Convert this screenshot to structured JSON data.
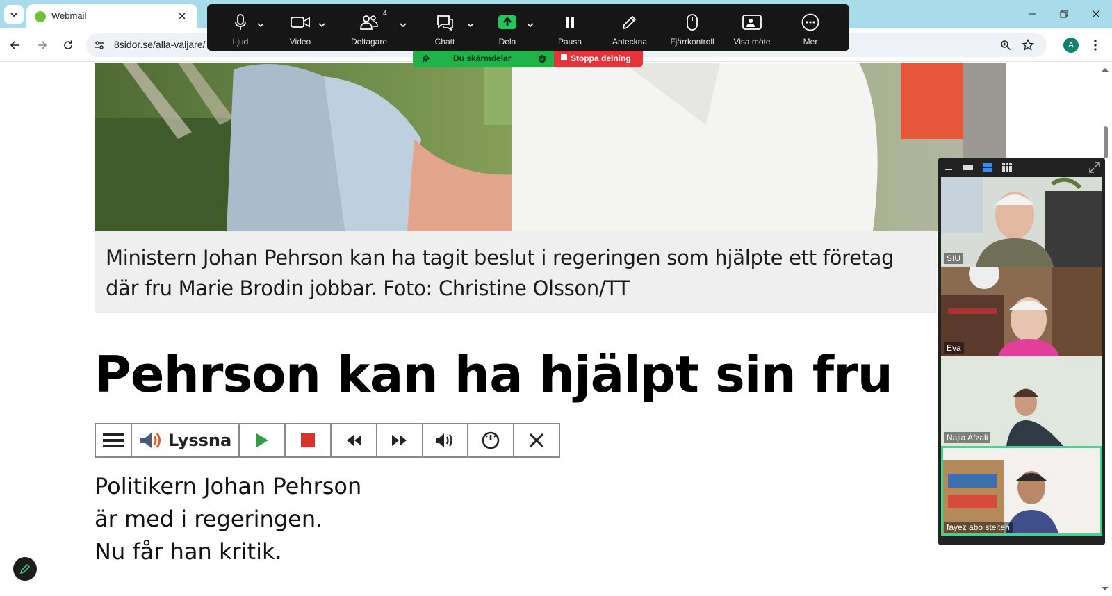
{
  "browser": {
    "tab_title": "Webmail",
    "url": "8sidor.se/alla-valjare/",
    "profile_initial": "A"
  },
  "zoom_toolbar": {
    "audio_label": "Ljud",
    "video_label": "Video",
    "participants_label": "Deltagare",
    "participants_count": "4",
    "chat_label": "Chatt",
    "share_label": "Dela",
    "pause_label": "Pausa",
    "annotate_label": "Anteckna",
    "remote_label": "Fjärrkontroll",
    "view_label": "Visa möte",
    "more_label": "Mer",
    "sharing_status": "Du skärmdelar",
    "stop_sharing": "Stoppa delning"
  },
  "article": {
    "image_caption": "Ministern Johan Pehrson kan ha tagit beslut i regeringen som hjälpte ett företag där fru Marie Brodin jobbar. Foto: Christine Olsson/TT",
    "headline": "Pehrson kan ha hjälpt sin fru",
    "listen_label": "Lyssna",
    "body_lines": [
      "Politikern Johan Pehrson",
      "är med i regeringen.",
      "Nu får han kritik."
    ]
  },
  "participants": [
    {
      "name": "SIU"
    },
    {
      "name": "Eva"
    },
    {
      "name": "Najia Afzali"
    },
    {
      "name": "fayez abo steiteh"
    }
  ],
  "colors": {
    "tabstrip": "#a8dcea",
    "zoom_bar": "#161616",
    "share_green": "#21b24a",
    "stop_red": "#e7323c",
    "active_speaker": "#3dd68c"
  }
}
